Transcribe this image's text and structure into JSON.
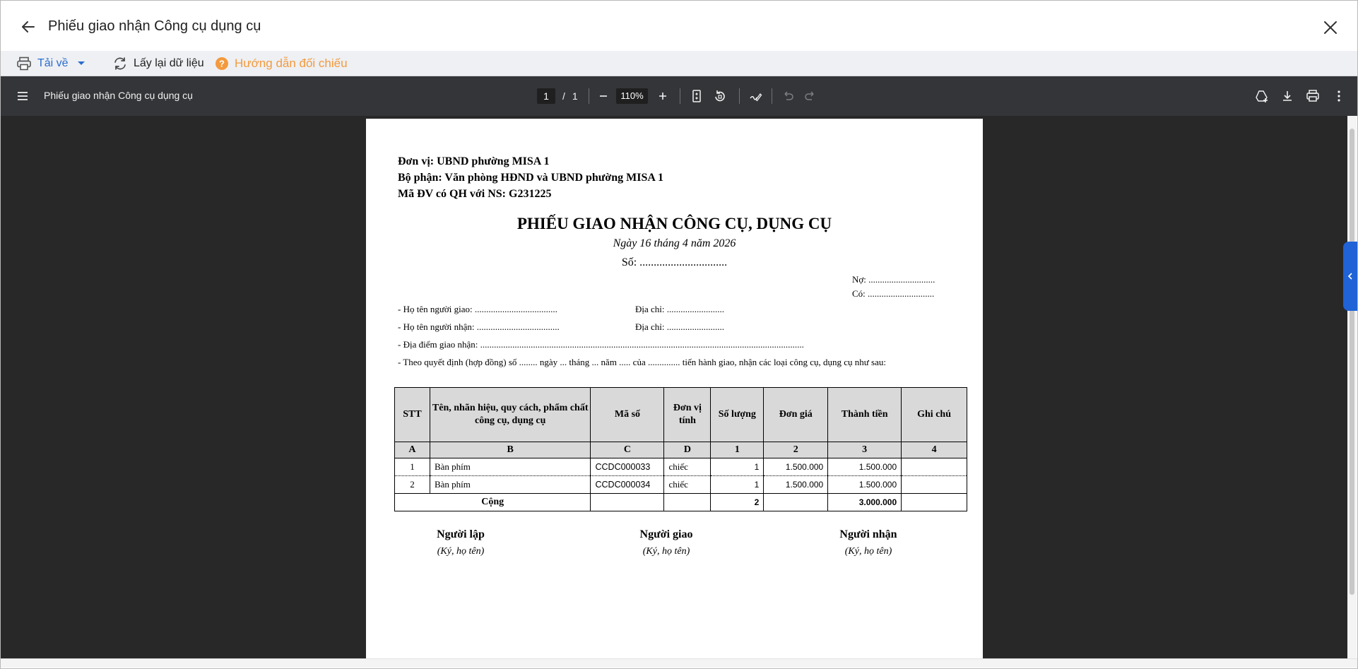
{
  "window": {
    "title": "Phiếu giao nhận Công cụ dụng cụ"
  },
  "actions": {
    "download_label": "Tải về",
    "reload_label": "Lấy lại dữ liệu",
    "guide_label": "Hướng dẫn đối chiếu"
  },
  "pdf_toolbar": {
    "title": "Phiếu giao nhận Công cụ dụng cụ",
    "current_page": "1",
    "separator": "/",
    "total_pages": "1",
    "zoom": "110%"
  },
  "document": {
    "unit": "Đơn vị: UBND phường MISA 1",
    "department": "Bộ phận: Văn phòng HĐND và UBND phường MISA 1",
    "budget_code": "Mã ĐV có QH với NS: G231225",
    "title": "PHIẾU GIAO NHẬN CÔNG CỤ, DỤNG CỤ",
    "date": "Ngày 16 tháng 4 năm 2026",
    "number": "Số: ...............................",
    "debit": "Nợ: .............................",
    "credit": "Có: .............................",
    "giver_name": "- Họ tên người giao: ....................................",
    "giver_address": "Địa chỉ: .........................",
    "receiver_name": "- Họ tên người nhận: ....................................",
    "receiver_address": "Địa chỉ: .........................",
    "location": "- Địa điểm giao nhận: .............................................................................................................................................",
    "decision": "- Theo quyết định (hợp đồng) số ........ ngày ... tháng ... năm ..... của .............. tiến hành giao, nhận các loại công cụ, dụng cụ như sau:",
    "table": {
      "headers": [
        "STT",
        "Tên, nhãn hiệu, quy cách, phẩm chất công cụ, dụng cụ",
        "Mã số",
        "Đơn vị tính",
        "Số lượng",
        "Đơn giá",
        "Thành tiền",
        "Ghi chú"
      ],
      "codes": [
        "A",
        "B",
        "C",
        "D",
        "1",
        "2",
        "3",
        "4"
      ],
      "rows": [
        {
          "stt": "1",
          "name": "Bàn phím",
          "code": "CCDC000033",
          "unit": "chiếc",
          "qty": "1",
          "price": "1.500.000",
          "amount": "1.500.000",
          "note": ""
        },
        {
          "stt": "2",
          "name": "Bàn phím",
          "code": "CCDC000034",
          "unit": "chiếc",
          "qty": "1",
          "price": "1.500.000",
          "amount": "1.500.000",
          "note": ""
        }
      ],
      "total": {
        "label": "Cộng",
        "qty": "2",
        "amount": "3.000.000"
      }
    },
    "signatures": [
      {
        "title": "Người lập",
        "sub": "(Ký, họ tên)"
      },
      {
        "title": "Người giao",
        "sub": "(Ký, họ tên)"
      },
      {
        "title": "Người nhận",
        "sub": "(Ký, họ tên)"
      }
    ]
  }
}
